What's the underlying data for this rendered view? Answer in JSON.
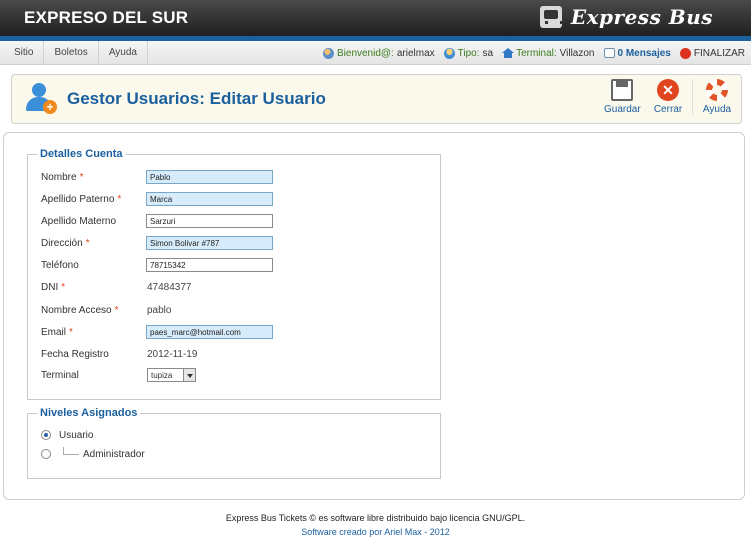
{
  "header": {
    "site_title": "EXPRESO DEL SUR",
    "brand_name": "Express Bus",
    "accent_color": "#1a5f9e"
  },
  "menu": {
    "items": [
      "Sitio",
      "Boletos",
      "Ayuda"
    ],
    "welcome_label": "Bienvenid@:",
    "welcome_user": "arielmax",
    "type_label": "Tipo:",
    "type_value": "sa",
    "terminal_label": "Terminal:",
    "terminal_value": "Villazon",
    "messages": "0 Mensajes",
    "logout": "FINALIZAR"
  },
  "toolbar": {
    "title": "Gestor Usuarios: Editar Usuario",
    "save_label": "Guardar",
    "close_label": "Cerrar",
    "help_label": "Ayuda"
  },
  "account": {
    "legend": "Detalles Cuenta",
    "nombre_label": "Nombre",
    "nombre_value": "Pablo",
    "paterno_label": "Apellido Paterno",
    "paterno_value": "Marca",
    "materno_label": "Apellido Materno",
    "materno_value": "Sarzuri",
    "direccion_label": "Dirección",
    "direccion_value": "Simon Bolivar #787",
    "telefono_label": "Teléfono",
    "telefono_value": "78715342",
    "dni_label": "DNI",
    "dni_value": "47484377",
    "acceso_label": "Nombre Acceso",
    "acceso_value": "pablo",
    "email_label": "Email",
    "email_value": "paes_marc@hotmail.com",
    "registro_label": "Fecha Registro",
    "registro_value": "2012-11-19",
    "terminal_label": "Terminal",
    "terminal_value": "tupiza",
    "required_mark": "*"
  },
  "levels": {
    "legend": "Niveles Asignados",
    "options": [
      {
        "label": "Usuario",
        "checked": true
      },
      {
        "label": "Administrador",
        "checked": false
      }
    ]
  },
  "footer": {
    "line1": "Express Bus Tickets © es software libre distribuido bajo licencia GNU/GPL.",
    "line2": "Software creado por Ariel Max - 2012"
  }
}
